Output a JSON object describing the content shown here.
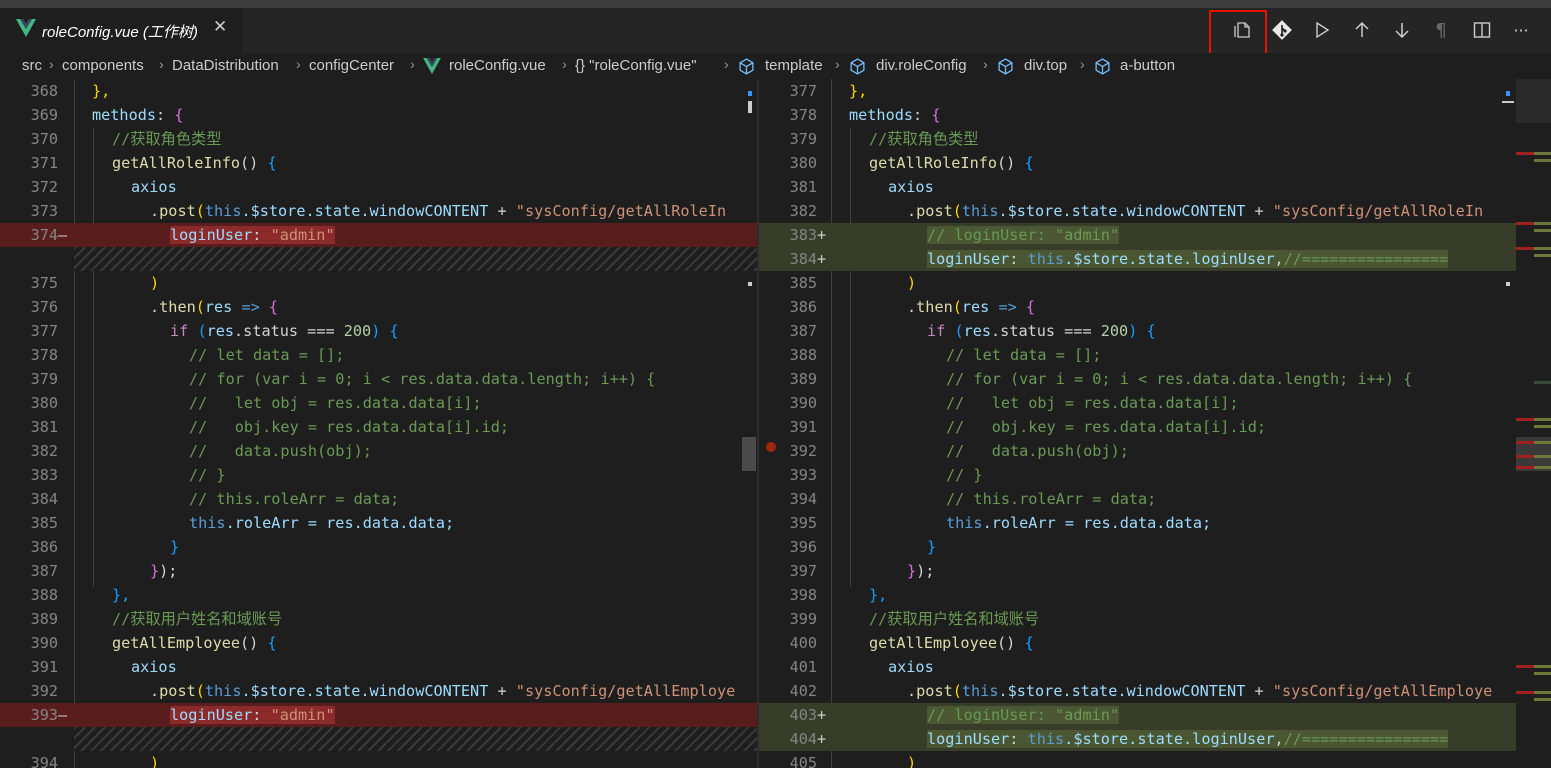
{
  "tab": {
    "title": "roleConfig.vue (工作树)",
    "close": "✕"
  },
  "toolbar": {
    "icons": [
      "open-file-icon",
      "git-icon",
      "run-icon",
      "prev-change-icon",
      "next-change-icon",
      "whitespace-icon",
      "split-editor-icon",
      "more-actions-icon"
    ]
  },
  "breadcrumb": [
    "src",
    "components",
    "DataDistribution",
    "configCenter",
    "roleConfig.vue",
    "{} \"roleConfig.vue\"",
    "template",
    "div.roleConfig",
    "div.top",
    "a-button"
  ],
  "left": {
    "lines": [
      "368",
      "369",
      "370",
      "371",
      "372",
      "373",
      "374",
      "",
      "375",
      "376",
      "377",
      "378",
      "379",
      "380",
      "381",
      "382",
      "383",
      "384",
      "385",
      "386",
      "387",
      "388",
      "389",
      "390",
      "391",
      "392",
      "393",
      "",
      "394"
    ],
    "markers": {
      "6": "—",
      "26": "—"
    }
  },
  "right": {
    "lines": [
      "377",
      "378",
      "379",
      "380",
      "381",
      "382",
      "383",
      "384",
      "385",
      "386",
      "387",
      "388",
      "389",
      "390",
      "391",
      "392",
      "393",
      "394",
      "395",
      "396",
      "397",
      "398",
      "399",
      "400",
      "401",
      "402",
      "403",
      "404",
      "405"
    ],
    "markers": {
      "6": "+",
      "7": "+",
      "26": "+",
      "27": "+"
    }
  },
  "code": {
    "l0": "},",
    "l1a": "methods",
    "l1b": ": ",
    "l1c": "{",
    "l2": "//获取角色类型",
    "l3a": "getAllRoleInfo",
    "l3b": "() ",
    "l3c": "{",
    "l4": "axios",
    "l5a": ".",
    "l5b": "post",
    "l5c": "(",
    "l5d": "this",
    "l5e": ".$store.state.windowCONTENT",
    "l5f": " + ",
    "l5g": "\"sysConfig/getAllRoleIn",
    "l6a": "loginUser",
    "l6b": ": ",
    "l6c": "\"admin\"",
    "r6": "// loginUser: \"admin\"",
    "r7a": "loginUser",
    "r7b": ": ",
    "r7c": "this",
    "r7d": ".$store.state.loginUser",
    "r7e": ",",
    "r7f": "//================",
    "l8": ")",
    "l9a": ".",
    "l9b": "then",
    "l9c": "(",
    "l9d": "res",
    "l9e": " => ",
    "l9f": "{",
    "l10a": "if",
    "l10b": " (",
    "l10c": "res",
    "l10d": ".status === ",
    "l10e": "200",
    "l10f": ") ",
    "l10g": "{",
    "l11": "// let data = [];",
    "l12": "// for (var i = 0; i < res.data.data.length; i++) {",
    "l13": "//   let obj = res.data.data[i];",
    "l14": "//   obj.key = res.data.data[i].id;",
    "l15": "//   data.push(obj);",
    "l16": "// }",
    "l17": "// this.roleArr = data;",
    "l18a": "this",
    "l18b": ".roleArr = res.data.data;",
    "l19": "}",
    "l20a": "}",
    "l20b": ");",
    "l21": "},",
    "l22": "//获取用户姓名和域账号",
    "l23a": "getAllEmployee",
    "l23b": "() ",
    "l23c": "{",
    "l25g": "\"sysConfig/getAllEmploye",
    "l28": ")"
  }
}
